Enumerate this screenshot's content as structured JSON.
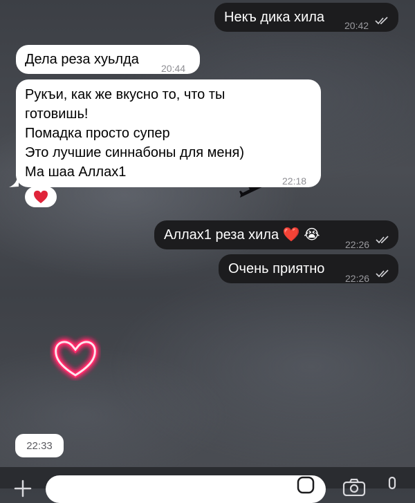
{
  "messages": [
    {
      "text": "Некъ дика хила",
      "time": "20:42",
      "direction": "outgoing",
      "status": "read"
    },
    {
      "text": "Дела реза хуьлда",
      "time": "20:44",
      "direction": "incoming"
    },
    {
      "lines": [
        "Рукъи, как же вкусно то, что ты",
        "готовишь!",
        "Помадка просто супер",
        "Это лучшие синнабоны для меня)",
        "Ма шаа Аллах1"
      ],
      "time": "22:18",
      "direction": "incoming",
      "reaction": "red-heart"
    },
    {
      "text": "Аллах1 реза хила ❤️ 😭",
      "time": "22:26",
      "direction": "outgoing",
      "status": "read"
    },
    {
      "text": "Очень приятно",
      "time": "22:26",
      "direction": "outgoing",
      "status": "read"
    }
  ],
  "media": {
    "caption_time": "22:33",
    "icon": "neon-heart-icon"
  },
  "input": {
    "placeholder": ""
  },
  "colors": {
    "incoming_bg": "#ffffff",
    "outgoing_bg": "#1c1c1e",
    "heart": "#e0243a"
  }
}
